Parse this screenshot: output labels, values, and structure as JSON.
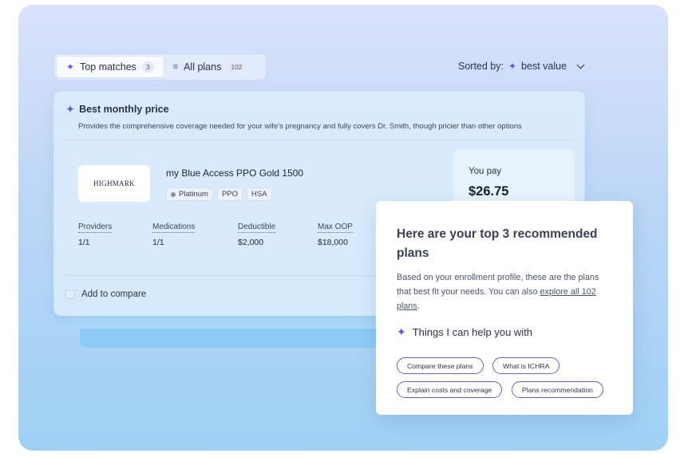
{
  "tabs": [
    {
      "label": "Top matches",
      "count": "3",
      "icon": "sparkle-icon"
    },
    {
      "label": "All plans",
      "count": "102",
      "icon": "list-icon"
    }
  ],
  "sort": {
    "label": "Sorted by:",
    "value": "best value"
  },
  "card": {
    "title": "Best monthly price",
    "description": "Provides the comprehensive coverage needed for your wife's pregnancy and fully covers Dr. Smith, though pricier than other options",
    "logo_text": "HIGHMARK",
    "plan_name": "my Blue Access PPO Gold 1500",
    "badges": [
      "Platinum",
      "PPO",
      "HSA"
    ],
    "pay_label": "You pay",
    "pay_value": "$26.75",
    "stats": [
      {
        "label": "Providers",
        "value": "1/1"
      },
      {
        "label": "Medications",
        "value": "1/1"
      },
      {
        "label": "Deductible",
        "value": "$2,000"
      },
      {
        "label": "Max OOP",
        "value": "$18,000"
      }
    ],
    "compare_label": "Add to compare"
  },
  "popup": {
    "title": "Here are your top 3 recommended plans",
    "text_before": "Based on your enrollment profile, these are the plans that best fit your needs. You can also ",
    "link": "explore all 102 plans",
    "text_after": ".",
    "help_title": "Things I can help you with",
    "chips": [
      "Compare these plans",
      "What is ICHRA",
      "Explain costs and coverage",
      "Plans recommendation"
    ]
  },
  "colors": {
    "accent": "#5b55e0",
    "chip_border": "#6b5dd6"
  }
}
